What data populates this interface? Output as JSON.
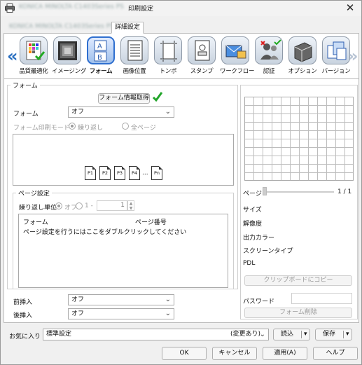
{
  "window": {
    "title_blurred": "KONICA MINOLTA C1403Series PS",
    "title": "印刷設定",
    "close_glyph": "✕"
  },
  "tabs": [
    {
      "label": "KONICA MINOLTA C1403Series PS",
      "blurred": true
    },
    {
      "label": "詳細設定",
      "blurred": false
    }
  ],
  "categories": [
    "品質最適化",
    "イメージング",
    "フォーム",
    "画像位置",
    "トンボ",
    "スタンプ",
    "ワークフロー",
    "認証",
    "オプション",
    "バージョン"
  ],
  "selected_category": "フォーム",
  "nav": {
    "left": "«",
    "right": "»"
  },
  "form": {
    "section_title": "フォーム",
    "get_info_button": "フォーム情報取得",
    "form_label": "フォーム",
    "form_value": "オフ",
    "print_mode_label": "フォーム印刷モード",
    "mode_repeat": "繰り返し",
    "mode_all": "全ページ",
    "pages": [
      "P1",
      "P2",
      "P3",
      "P4",
      "...",
      "Pn"
    ]
  },
  "page_settings": {
    "title": "ページ設定",
    "repeat_unit_label": "繰り返し単位",
    "opt_off": "オフ",
    "opt_1": "1 -",
    "spin_value": "1",
    "col_form": "フォーム",
    "col_page": "ページ番号",
    "hint": "ページ設定を行うにはここをダブルクリックしてください"
  },
  "insert": {
    "front_label": "前挿入",
    "front_value": "オフ",
    "back_label": "後挿入",
    "back_value": "オフ"
  },
  "preview": {
    "page_label": "ページ",
    "page_count": "1 / 1",
    "size_label": "サイズ",
    "resolution_label": "解像度",
    "color_label": "出力カラー",
    "screen_label": "スクリーンタイプ",
    "pdl_label": "PDL",
    "copy_button": "クリップボードにコピー",
    "password_label": "パスワード",
    "delete_button": "フォーム削除"
  },
  "favorites": {
    "label": "お気に入り",
    "value": "標準設定",
    "changed": "(変更あり)",
    "load_button": "読込",
    "save_button": "保存"
  },
  "footer": {
    "ok": "OK",
    "cancel": "キャンセル",
    "apply": "適用(A)",
    "help": "ヘルプ"
  }
}
